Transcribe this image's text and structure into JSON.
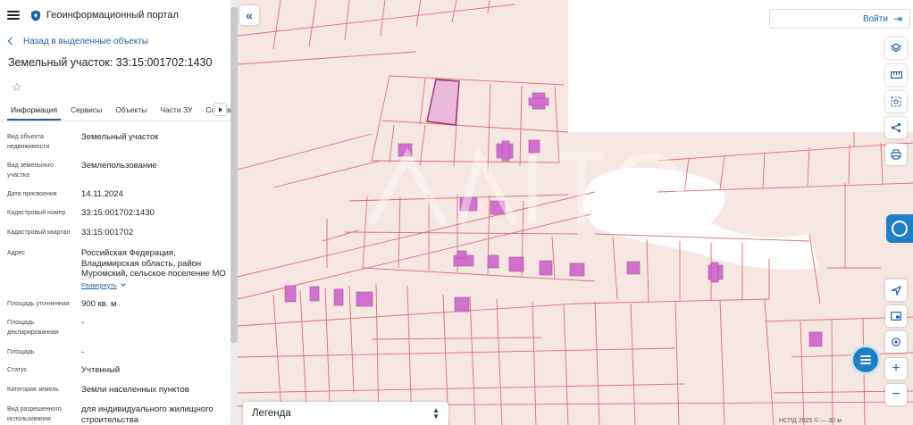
{
  "header": {
    "app_title": "Геоинформационный портал"
  },
  "nav": {
    "back_label": "Назад в выделенные объекты"
  },
  "object": {
    "title": "Земельный участок: 33:15:001702:1430"
  },
  "tabs": [
    {
      "label": "Информация",
      "active": true
    },
    {
      "label": "Сервисы"
    },
    {
      "label": "Объекты"
    },
    {
      "label": "Части ЗУ"
    },
    {
      "label": "Состав"
    }
  ],
  "attributes": [
    {
      "label": "Вид объекта недвижимости",
      "value": "Земельный участок"
    },
    {
      "label": "Вид земельного участка",
      "value": "Землепользование"
    },
    {
      "label": "Дата присвоения",
      "value": "14.11.2024"
    },
    {
      "label": "Кадастровый номер",
      "value": "33:15:001702:1430"
    },
    {
      "label": "Кадастровый квартал",
      "value": "33:15:001702"
    },
    {
      "label": "Адрес",
      "value": "Российская Федерация, Владимирская область, район Муромский, сельское поселение МО",
      "expand_label": "Развернуть"
    },
    {
      "label": "Площадь уточненная",
      "value": "900 кв. м"
    },
    {
      "label": "Площадь декларированная",
      "value": "-"
    },
    {
      "label": "Площадь",
      "value": "-"
    },
    {
      "label": "Статус",
      "value": "Учтенный"
    },
    {
      "label": "Категория земель",
      "value": "Земли населенных пунктов"
    },
    {
      "label": "Вид разрешенного использования",
      "value": "для индивидуального жилищного строительства"
    }
  ],
  "map": {
    "login_label": "Войти",
    "legend_label": "Легенда",
    "scale_text": "НСПД 2025  ©  —  30 м",
    "colors": {
      "background": "#f6e7e3",
      "parcel_line": "#d86b72",
      "building": "#d36fcf",
      "selected_parcel": "#e9b8da",
      "accent": "#1f5fa8"
    }
  },
  "icons": {
    "menu": "hamburger-icon",
    "logo": "portal-logo-icon",
    "back": "chevron-left-icon",
    "favorite": "star-icon",
    "collapse": "double-chevron-left-icon",
    "login": "login-icon",
    "tools": [
      "layers-icon",
      "ruler-icon",
      "select-area-icon",
      "share-icon",
      "print-icon",
      "locate-icon",
      "basemap-icon",
      "geolocation-icon",
      "zoom-in-icon",
      "zoom-out-icon"
    ]
  }
}
